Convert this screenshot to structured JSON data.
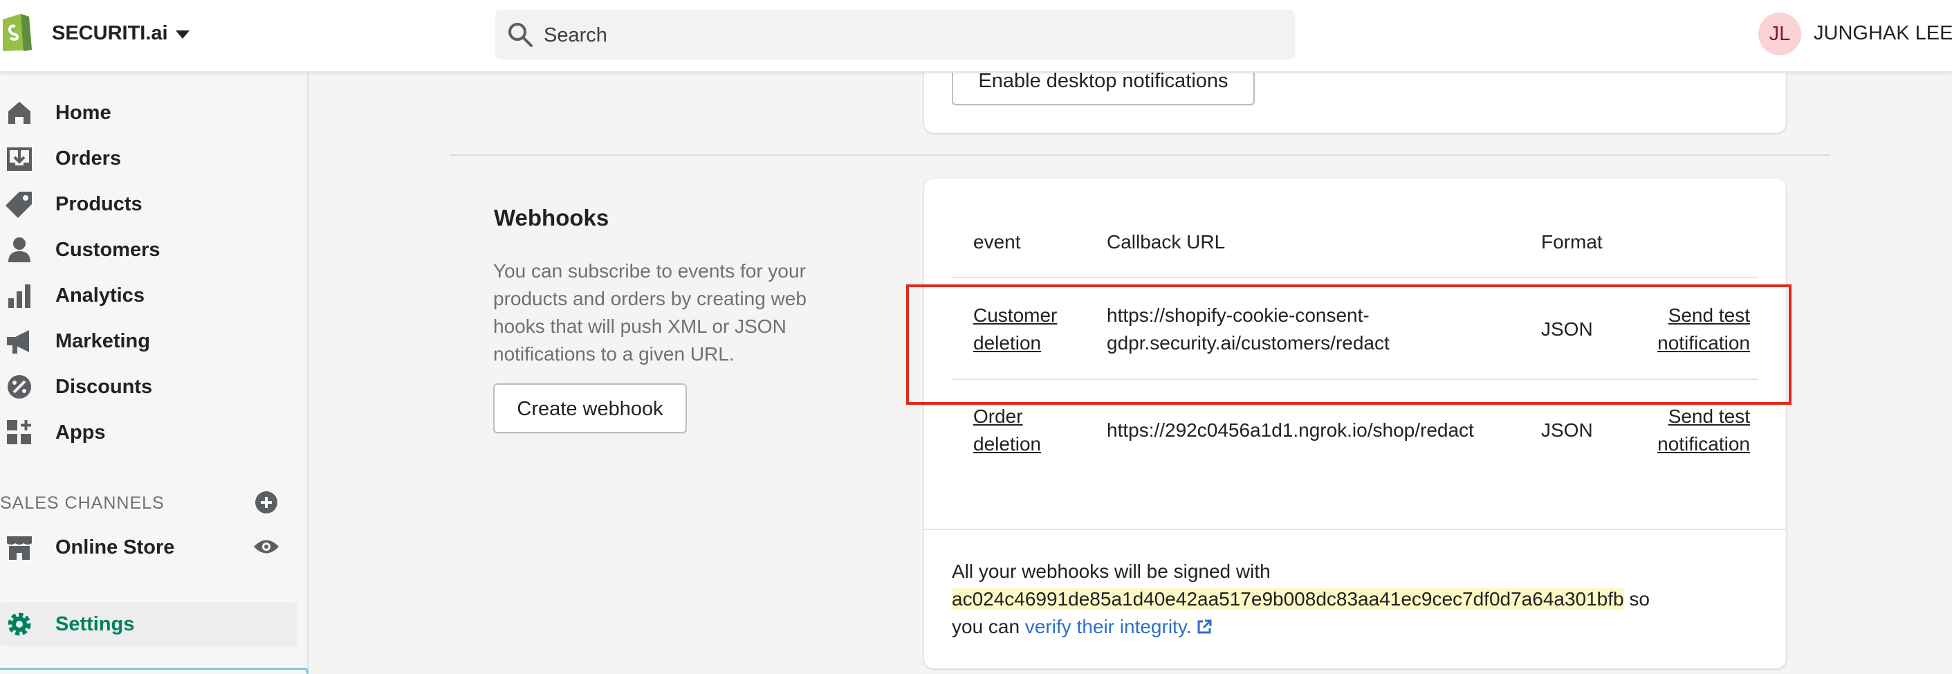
{
  "header": {
    "store_name": "SECURITI.ai",
    "search_placeholder": "Search",
    "avatar_initials": "JL",
    "user_name": "JUNGHAK LEE"
  },
  "sidebar": {
    "items": [
      {
        "label": "Home",
        "icon": "home-icon"
      },
      {
        "label": "Orders",
        "icon": "orders-icon"
      },
      {
        "label": "Products",
        "icon": "tag-icon"
      },
      {
        "label": "Customers",
        "icon": "person-icon"
      },
      {
        "label": "Analytics",
        "icon": "bar-chart-icon"
      },
      {
        "label": "Marketing",
        "icon": "megaphone-icon"
      },
      {
        "label": "Discounts",
        "icon": "discount-icon"
      },
      {
        "label": "Apps",
        "icon": "apps-icon"
      }
    ],
    "sales_channels_label": "SALES CHANNELS",
    "online_store_label": "Online Store",
    "settings_label": "Settings"
  },
  "notifications": {
    "enable_desktop_label": "Enable desktop notifications"
  },
  "webhooks": {
    "title": "Webhooks",
    "description": "You can subscribe to events for your products and orders by creating web hooks that will push XML or JSON notifications to a given URL.",
    "create_button": "Create webhook",
    "columns": [
      "event",
      "Callback URL",
      "Format"
    ],
    "rows": [
      {
        "event_line1": "Customer",
        "event_line2": "deletion",
        "url_line1": "https://shopify-cookie-consent-",
        "url_line2": "gdpr.security.ai/customers/redact",
        "format": "JSON",
        "action_line1": "Send test",
        "action_line2": "notification"
      },
      {
        "event_line1": "Order",
        "event_line2": "deletion",
        "url_line1": "https://292c0456a1d1.ngrok.io/shop/redact",
        "url_line2": "",
        "format": "JSON",
        "action_line1": "Send test",
        "action_line2": "notification"
      }
    ],
    "signed_prefix": "All your webhooks will be signed with",
    "signature": "ac024c46991de85a1d40e42aa517e9b008dc83aa41ec9cec7df0d7a64a301bfb",
    "signed_suffix": " so",
    "verify_prefix": "you can ",
    "verify_link": "verify their integrity."
  },
  "colors": {
    "accent_green": "#008060",
    "highlight_red": "#e3291b",
    "link_blue": "#2c6ecb",
    "hash_highlight": "#fdf9c7"
  }
}
